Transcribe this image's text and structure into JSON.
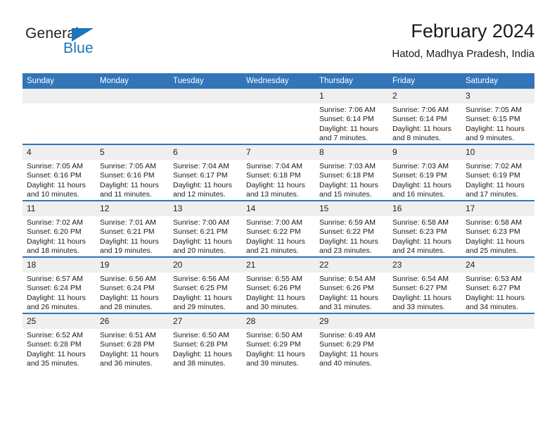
{
  "logo": {
    "word1": "General",
    "word2": "Blue",
    "triangle_color": "#1b75bb",
    "text_color": "#231f20"
  },
  "header": {
    "title": "February 2024",
    "subtitle": "Hatod, Madhya Pradesh, India"
  },
  "colors": {
    "header_blue": "#3275b8",
    "daynum_band": "#efefef",
    "text": "#1a1a1a"
  },
  "weekday_headers": [
    "Sunday",
    "Monday",
    "Tuesday",
    "Wednesday",
    "Thursday",
    "Friday",
    "Saturday"
  ],
  "weeks": [
    [
      {
        "day": "",
        "sunrise": "",
        "sunset": "",
        "daylight1": "",
        "daylight2": ""
      },
      {
        "day": "",
        "sunrise": "",
        "sunset": "",
        "daylight1": "",
        "daylight2": ""
      },
      {
        "day": "",
        "sunrise": "",
        "sunset": "",
        "daylight1": "",
        "daylight2": ""
      },
      {
        "day": "",
        "sunrise": "",
        "sunset": "",
        "daylight1": "",
        "daylight2": ""
      },
      {
        "day": "1",
        "sunrise": "Sunrise: 7:06 AM",
        "sunset": "Sunset: 6:14 PM",
        "daylight1": "Daylight: 11 hours",
        "daylight2": "and 7 minutes."
      },
      {
        "day": "2",
        "sunrise": "Sunrise: 7:06 AM",
        "sunset": "Sunset: 6:14 PM",
        "daylight1": "Daylight: 11 hours",
        "daylight2": "and 8 minutes."
      },
      {
        "day": "3",
        "sunrise": "Sunrise: 7:05 AM",
        "sunset": "Sunset: 6:15 PM",
        "daylight1": "Daylight: 11 hours",
        "daylight2": "and 9 minutes."
      }
    ],
    [
      {
        "day": "4",
        "sunrise": "Sunrise: 7:05 AM",
        "sunset": "Sunset: 6:16 PM",
        "daylight1": "Daylight: 11 hours",
        "daylight2": "and 10 minutes."
      },
      {
        "day": "5",
        "sunrise": "Sunrise: 7:05 AM",
        "sunset": "Sunset: 6:16 PM",
        "daylight1": "Daylight: 11 hours",
        "daylight2": "and 11 minutes."
      },
      {
        "day": "6",
        "sunrise": "Sunrise: 7:04 AM",
        "sunset": "Sunset: 6:17 PM",
        "daylight1": "Daylight: 11 hours",
        "daylight2": "and 12 minutes."
      },
      {
        "day": "7",
        "sunrise": "Sunrise: 7:04 AM",
        "sunset": "Sunset: 6:18 PM",
        "daylight1": "Daylight: 11 hours",
        "daylight2": "and 13 minutes."
      },
      {
        "day": "8",
        "sunrise": "Sunrise: 7:03 AM",
        "sunset": "Sunset: 6:18 PM",
        "daylight1": "Daylight: 11 hours",
        "daylight2": "and 15 minutes."
      },
      {
        "day": "9",
        "sunrise": "Sunrise: 7:03 AM",
        "sunset": "Sunset: 6:19 PM",
        "daylight1": "Daylight: 11 hours",
        "daylight2": "and 16 minutes."
      },
      {
        "day": "10",
        "sunrise": "Sunrise: 7:02 AM",
        "sunset": "Sunset: 6:19 PM",
        "daylight1": "Daylight: 11 hours",
        "daylight2": "and 17 minutes."
      }
    ],
    [
      {
        "day": "11",
        "sunrise": "Sunrise: 7:02 AM",
        "sunset": "Sunset: 6:20 PM",
        "daylight1": "Daylight: 11 hours",
        "daylight2": "and 18 minutes."
      },
      {
        "day": "12",
        "sunrise": "Sunrise: 7:01 AM",
        "sunset": "Sunset: 6:21 PM",
        "daylight1": "Daylight: 11 hours",
        "daylight2": "and 19 minutes."
      },
      {
        "day": "13",
        "sunrise": "Sunrise: 7:00 AM",
        "sunset": "Sunset: 6:21 PM",
        "daylight1": "Daylight: 11 hours",
        "daylight2": "and 20 minutes."
      },
      {
        "day": "14",
        "sunrise": "Sunrise: 7:00 AM",
        "sunset": "Sunset: 6:22 PM",
        "daylight1": "Daylight: 11 hours",
        "daylight2": "and 21 minutes."
      },
      {
        "day": "15",
        "sunrise": "Sunrise: 6:59 AM",
        "sunset": "Sunset: 6:22 PM",
        "daylight1": "Daylight: 11 hours",
        "daylight2": "and 23 minutes."
      },
      {
        "day": "16",
        "sunrise": "Sunrise: 6:58 AM",
        "sunset": "Sunset: 6:23 PM",
        "daylight1": "Daylight: 11 hours",
        "daylight2": "and 24 minutes."
      },
      {
        "day": "17",
        "sunrise": "Sunrise: 6:58 AM",
        "sunset": "Sunset: 6:23 PM",
        "daylight1": "Daylight: 11 hours",
        "daylight2": "and 25 minutes."
      }
    ],
    [
      {
        "day": "18",
        "sunrise": "Sunrise: 6:57 AM",
        "sunset": "Sunset: 6:24 PM",
        "daylight1": "Daylight: 11 hours",
        "daylight2": "and 26 minutes."
      },
      {
        "day": "19",
        "sunrise": "Sunrise: 6:56 AM",
        "sunset": "Sunset: 6:24 PM",
        "daylight1": "Daylight: 11 hours",
        "daylight2": "and 28 minutes."
      },
      {
        "day": "20",
        "sunrise": "Sunrise: 6:56 AM",
        "sunset": "Sunset: 6:25 PM",
        "daylight1": "Daylight: 11 hours",
        "daylight2": "and 29 minutes."
      },
      {
        "day": "21",
        "sunrise": "Sunrise: 6:55 AM",
        "sunset": "Sunset: 6:26 PM",
        "daylight1": "Daylight: 11 hours",
        "daylight2": "and 30 minutes."
      },
      {
        "day": "22",
        "sunrise": "Sunrise: 6:54 AM",
        "sunset": "Sunset: 6:26 PM",
        "daylight1": "Daylight: 11 hours",
        "daylight2": "and 31 minutes."
      },
      {
        "day": "23",
        "sunrise": "Sunrise: 6:54 AM",
        "sunset": "Sunset: 6:27 PM",
        "daylight1": "Daylight: 11 hours",
        "daylight2": "and 33 minutes."
      },
      {
        "day": "24",
        "sunrise": "Sunrise: 6:53 AM",
        "sunset": "Sunset: 6:27 PM",
        "daylight1": "Daylight: 11 hours",
        "daylight2": "and 34 minutes."
      }
    ],
    [
      {
        "day": "25",
        "sunrise": "Sunrise: 6:52 AM",
        "sunset": "Sunset: 6:28 PM",
        "daylight1": "Daylight: 11 hours",
        "daylight2": "and 35 minutes."
      },
      {
        "day": "26",
        "sunrise": "Sunrise: 6:51 AM",
        "sunset": "Sunset: 6:28 PM",
        "daylight1": "Daylight: 11 hours",
        "daylight2": "and 36 minutes."
      },
      {
        "day": "27",
        "sunrise": "Sunrise: 6:50 AM",
        "sunset": "Sunset: 6:28 PM",
        "daylight1": "Daylight: 11 hours",
        "daylight2": "and 38 minutes."
      },
      {
        "day": "28",
        "sunrise": "Sunrise: 6:50 AM",
        "sunset": "Sunset: 6:29 PM",
        "daylight1": "Daylight: 11 hours",
        "daylight2": "and 39 minutes."
      },
      {
        "day": "29",
        "sunrise": "Sunrise: 6:49 AM",
        "sunset": "Sunset: 6:29 PM",
        "daylight1": "Daylight: 11 hours",
        "daylight2": "and 40 minutes."
      },
      {
        "day": "",
        "sunrise": "",
        "sunset": "",
        "daylight1": "",
        "daylight2": ""
      },
      {
        "day": "",
        "sunrise": "",
        "sunset": "",
        "daylight1": "",
        "daylight2": ""
      }
    ]
  ]
}
